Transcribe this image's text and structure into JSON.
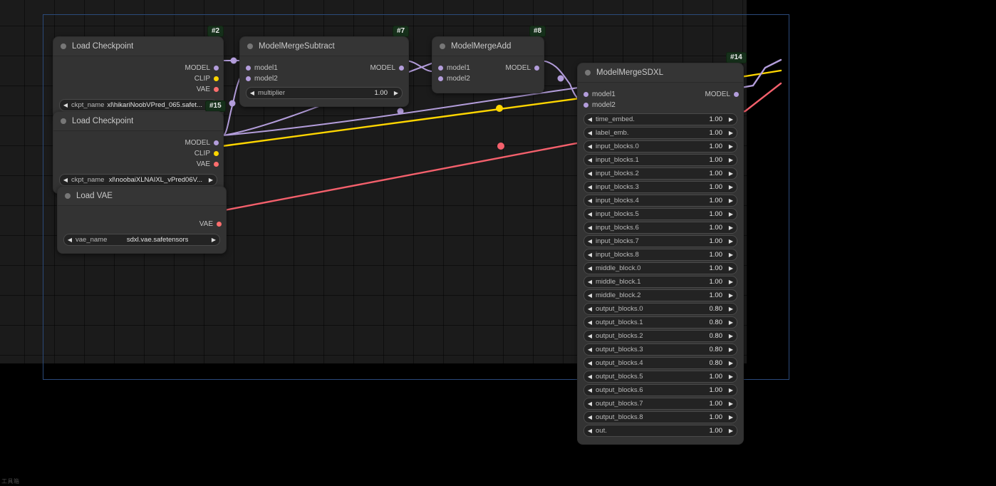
{
  "app": {
    "bottom_left_text": "工具箱"
  },
  "canvas": {
    "grid_color": "#1f1f1f",
    "selection_rect_color": "#2b4a7a"
  },
  "link_colors": {
    "MODEL": "#b39ddb",
    "CLIP": "#ffd600",
    "VAE": "#ff6e6e"
  },
  "nodes": [
    {
      "id": "#2",
      "title": "Load Checkpoint",
      "outputs": [
        {
          "label": "MODEL",
          "type": "MODEL"
        },
        {
          "label": "CLIP",
          "type": "CLIP"
        },
        {
          "label": "VAE",
          "type": "VAE"
        }
      ],
      "widgets": [
        {
          "name": "ckpt_name",
          "value": "xl\\hikariNoobVPred_065.safet...",
          "left_arrow": "◀",
          "right_arrow": "▶"
        }
      ]
    },
    {
      "id": "#15",
      "title": "Load Checkpoint",
      "outputs": [
        {
          "label": "MODEL",
          "type": "MODEL"
        },
        {
          "label": "CLIP",
          "type": "CLIP"
        },
        {
          "label": "VAE",
          "type": "VAE"
        }
      ],
      "widgets": [
        {
          "name": "ckpt_name",
          "value": "xl\\noobaiXLNAIXL_vPred06V...",
          "left_arrow": "◀",
          "right_arrow": "▶"
        }
      ]
    },
    {
      "id": "",
      "title": "Load VAE",
      "outputs": [
        {
          "label": "VAE",
          "type": "VAE"
        }
      ],
      "widgets": [
        {
          "name": "vae_name",
          "value": "sdxl.vae.safetensors",
          "left_arrow": "◀",
          "right_arrow": "▶"
        }
      ]
    },
    {
      "id": "#7",
      "title": "ModelMergeSubtract",
      "inputs": [
        {
          "label": "model1",
          "type": "MODEL"
        },
        {
          "label": "model2",
          "type": "MODEL"
        }
      ],
      "outputs": [
        {
          "label": "MODEL",
          "type": "MODEL"
        }
      ],
      "widgets": [
        {
          "name": "multiplier",
          "value": "1.00",
          "left_arrow": "◀",
          "right_arrow": "▶"
        }
      ]
    },
    {
      "id": "#8",
      "title": "ModelMergeAdd",
      "inputs": [
        {
          "label": "model1",
          "type": "MODEL"
        },
        {
          "label": "model2",
          "type": "MODEL"
        }
      ],
      "outputs": [
        {
          "label": "MODEL",
          "type": "MODEL"
        }
      ],
      "widgets": []
    },
    {
      "id": "#14",
      "title": "ModelMergeSDXL",
      "inputs": [
        {
          "label": "model1",
          "type": "MODEL"
        },
        {
          "label": "model2",
          "type": "MODEL"
        }
      ],
      "outputs": [
        {
          "label": "MODEL",
          "type": "MODEL"
        }
      ],
      "widgets": [
        {
          "name": "time_embed.",
          "value": "1.00",
          "left_arrow": "◀",
          "right_arrow": "▶"
        },
        {
          "name": "label_emb.",
          "value": "1.00",
          "left_arrow": "◀",
          "right_arrow": "▶"
        },
        {
          "name": "input_blocks.0",
          "value": "1.00",
          "left_arrow": "◀",
          "right_arrow": "▶"
        },
        {
          "name": "input_blocks.1",
          "value": "1.00",
          "left_arrow": "◀",
          "right_arrow": "▶"
        },
        {
          "name": "input_blocks.2",
          "value": "1.00",
          "left_arrow": "◀",
          "right_arrow": "▶"
        },
        {
          "name": "input_blocks.3",
          "value": "1.00",
          "left_arrow": "◀",
          "right_arrow": "▶"
        },
        {
          "name": "input_blocks.4",
          "value": "1.00",
          "left_arrow": "◀",
          "right_arrow": "▶"
        },
        {
          "name": "input_blocks.5",
          "value": "1.00",
          "left_arrow": "◀",
          "right_arrow": "▶"
        },
        {
          "name": "input_blocks.6",
          "value": "1.00",
          "left_arrow": "◀",
          "right_arrow": "▶"
        },
        {
          "name": "input_blocks.7",
          "value": "1.00",
          "left_arrow": "◀",
          "right_arrow": "▶"
        },
        {
          "name": "input_blocks.8",
          "value": "1.00",
          "left_arrow": "◀",
          "right_arrow": "▶"
        },
        {
          "name": "middle_block.0",
          "value": "1.00",
          "left_arrow": "◀",
          "right_arrow": "▶"
        },
        {
          "name": "middle_block.1",
          "value": "1.00",
          "left_arrow": "◀",
          "right_arrow": "▶"
        },
        {
          "name": "middle_block.2",
          "value": "1.00",
          "left_arrow": "◀",
          "right_arrow": "▶"
        },
        {
          "name": "output_blocks.0",
          "value": "0.80",
          "left_arrow": "◀",
          "right_arrow": "▶"
        },
        {
          "name": "output_blocks.1",
          "value": "0.80",
          "left_arrow": "◀",
          "right_arrow": "▶"
        },
        {
          "name": "output_blocks.2",
          "value": "0.80",
          "left_arrow": "◀",
          "right_arrow": "▶"
        },
        {
          "name": "output_blocks.3",
          "value": "0.80",
          "left_arrow": "◀",
          "right_arrow": "▶"
        },
        {
          "name": "output_blocks.4",
          "value": "0.80",
          "left_arrow": "◀",
          "right_arrow": "▶"
        },
        {
          "name": "output_blocks.5",
          "value": "1.00",
          "left_arrow": "◀",
          "right_arrow": "▶"
        },
        {
          "name": "output_blocks.6",
          "value": "1.00",
          "left_arrow": "◀",
          "right_arrow": "▶"
        },
        {
          "name": "output_blocks.7",
          "value": "1.00",
          "left_arrow": "◀",
          "right_arrow": "▶"
        },
        {
          "name": "output_blocks.8",
          "value": "1.00",
          "left_arrow": "◀",
          "right_arrow": "▶"
        },
        {
          "name": "out.",
          "value": "1.00",
          "left_arrow": "◀",
          "right_arrow": "▶"
        }
      ]
    }
  ]
}
